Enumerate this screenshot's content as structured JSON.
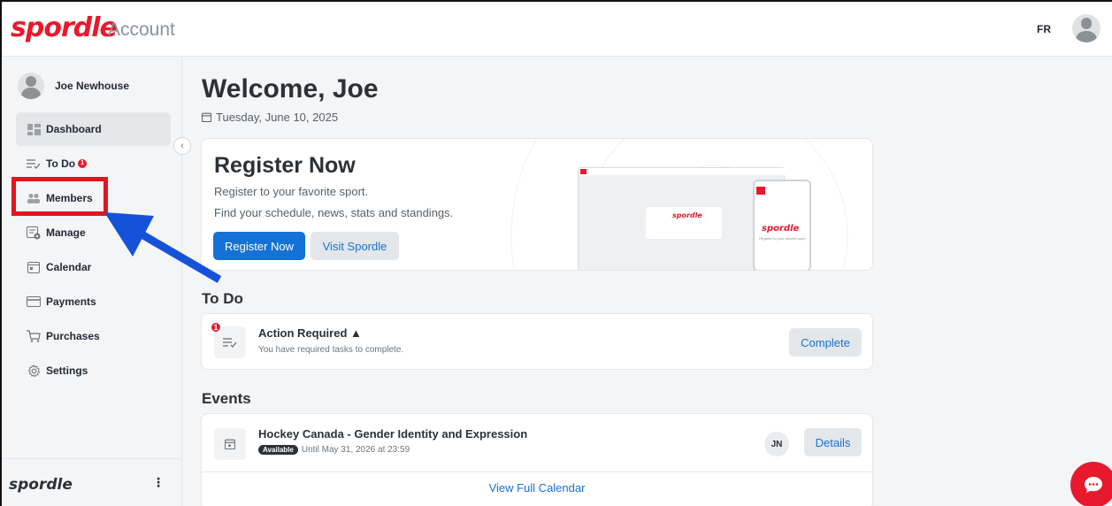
{
  "header": {
    "logo": "spordle",
    "app_name": "Account",
    "lang": "FR"
  },
  "sidebar": {
    "user_name": "Joe Newhouse",
    "items": [
      {
        "label": "Dashboard",
        "active": true,
        "icon": "dashboard-icon"
      },
      {
        "label": "To Do",
        "badge": "1",
        "icon": "todo-list-icon"
      },
      {
        "label": "Members",
        "icon": "members-icon"
      },
      {
        "label": "Manage",
        "icon": "manage-icon"
      },
      {
        "label": "Calendar",
        "icon": "calendar-icon"
      },
      {
        "label": "Payments",
        "icon": "credit-card-icon"
      },
      {
        "label": "Purchases",
        "icon": "cart-icon"
      },
      {
        "label": "Settings",
        "icon": "gear-icon"
      }
    ],
    "collapse_glyph": "‹",
    "footer_logo": "spordle",
    "footer_menu": "⋮"
  },
  "main": {
    "welcome": "Welcome, Joe",
    "date": "Tuesday, June 10, 2025",
    "register": {
      "title": "Register Now",
      "line1": "Register to your favorite sport.",
      "line2": "Find your schedule, news, stats and standings.",
      "primary_btn": "Register Now",
      "secondary_btn": "Visit Spordle",
      "preview_logo": "spordle",
      "preview_caption": "Register to your favorite sport."
    },
    "todo": {
      "section_title": "To Do",
      "badge": "1",
      "item_title": "Action Required",
      "warning_glyph": "▲",
      "item_desc": "You have required tasks to complete.",
      "button": "Complete"
    },
    "events": {
      "section_title": "Events",
      "item_title": "Hockey Canada - Gender Identity and Expression",
      "status_badge": "Available",
      "until": "Until May 31, 2026 at 23:59",
      "initials": "JN",
      "details_btn": "Details",
      "view_all": "View Full Calendar"
    }
  },
  "colors": {
    "brand_red": "#e8192c",
    "primary_blue": "#1471d6",
    "annotation_red": "#e0161e",
    "annotation_blue": "#1652d9"
  }
}
